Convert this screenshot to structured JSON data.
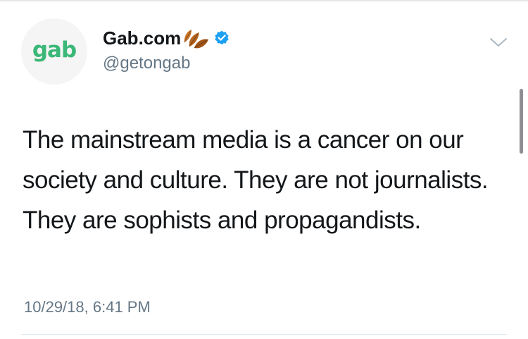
{
  "tweet": {
    "avatar_text": "gab",
    "display_name": "Gab.com",
    "handle": "@getongab",
    "verified": true,
    "body": "The mainstream media is a cancer on our society and culture. They are not journalists. They are sophists and propagandists.",
    "timestamp": "10/29/18, 6:41 PM"
  },
  "icons": {
    "name_emoji": "leaves-icon",
    "verified": "verified-badge-icon",
    "menu": "chevron-down-icon"
  },
  "colors": {
    "brand_green": "#3bb878",
    "verified_blue": "#1da1f2",
    "secondary_text": "#657786"
  }
}
